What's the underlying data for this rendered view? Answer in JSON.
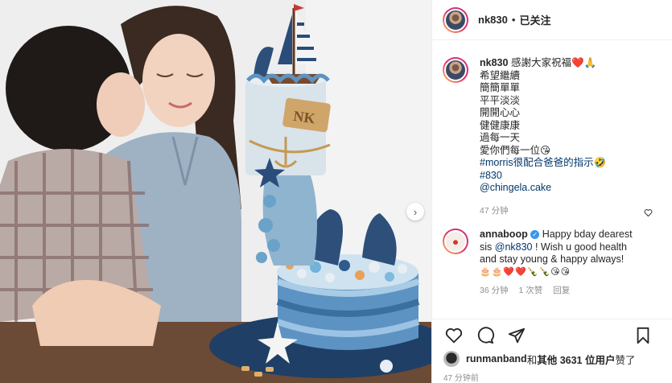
{
  "post": {
    "author": {
      "username": "nk830",
      "separator": "•",
      "follow_status": "已关注"
    },
    "caption": {
      "username": "nk830",
      "lines": [
        "感謝大家祝福❤️🙏",
        "希望繼續",
        "簡簡單單",
        "平平淡淡",
        "開開心心",
        "健健康康",
        "過每一天",
        "愛你們每一位😘"
      ],
      "hashtag_line": "#morris很配合爸爸的指示🤣",
      "hashtag": "#830",
      "mention": "@chingela.cake",
      "time": "47 分钟"
    },
    "comment": {
      "username": "annaboop",
      "text_line1": "Happy bday dearest",
      "text_line2": "sis ",
      "mention": "@nk830",
      "text_line2b": " ! Wish u good health",
      "text_line3": "and stay young & happy always!",
      "emojis": "🎂🎂❤️❤️🍾🍾😘😘",
      "time": "36 分钟",
      "replies": "1 次赞",
      "reply_label": "回复"
    },
    "likes": {
      "user": "runmanband",
      "mid": " 和 ",
      "others_label": "其他 3631 位用户",
      "suffix": " 赞了"
    },
    "timestamp": "47 分钟前"
  },
  "icons": [
    "heart-icon",
    "comment-icon",
    "share-icon",
    "bookmark-icon",
    "chevron-right-icon"
  ],
  "photo": {
    "cake_plaque_text": "NK"
  }
}
